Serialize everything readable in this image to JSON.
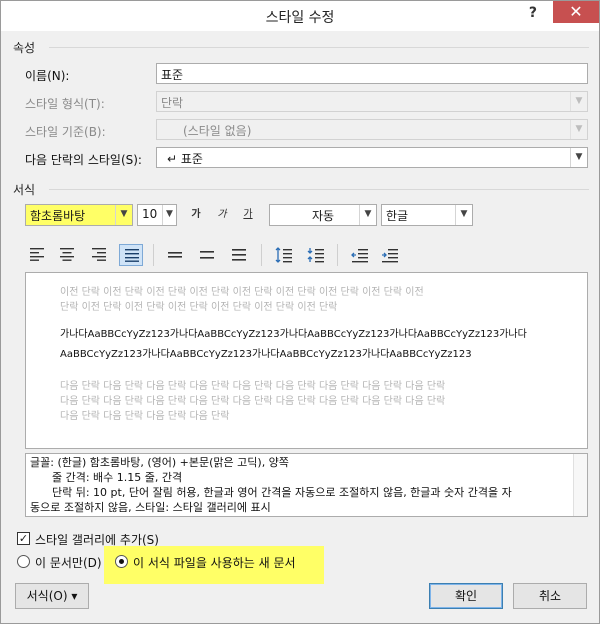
{
  "window": {
    "title": "스타일 수정",
    "help_label": "?",
    "close_label": "✕"
  },
  "properties": {
    "section_label": "속성",
    "name": {
      "label": "이름(N):",
      "value": "표준"
    },
    "style_type": {
      "label": "스타일 형식(T):",
      "value": "단락"
    },
    "based_on": {
      "label": "스타일 기준(B):",
      "value": "(스타일 없음)"
    },
    "next_style": {
      "label": "다음 단락의 스타일(S):",
      "value": "↵ 표준"
    }
  },
  "formatting": {
    "section_label": "서식",
    "font": "함초롬바탕",
    "size": "10",
    "bold_label": "가",
    "italic_label": "가",
    "underline_label": "가",
    "color": "자동",
    "script": "한글",
    "highlight_color": "#ffff66"
  },
  "preview": {
    "previous_lines": [
      "이전 단락 이전 단락 이전 단락 이전 단락 이전 단락 이전 단락 이전 단락 이전 단락 이전",
      "단락 이전 단락 이전 단락 이전 단락 이전 단락 이전 단락 이전 단락"
    ],
    "sample_lines": [
      "가나다AaBBCcYyZz123가나다AaBBCcYyZz123가나다AaBBCcYyZz123가나다AaBBCcYyZz123가나다",
      "AaBBCcYyZz123가나다AaBBCcYyZz123가나다AaBBCcYyZz123가나다AaBBCcYyZz123"
    ],
    "next_lines": [
      "다음 단락 다음 단락 다음 단락 다음 단락 다음 단락 다음 단락 다음 단락 다음 단락 다음 단락",
      "다음 단락 다음 단락 다음 단락 다음 단락 다음 단락 다음 단락 다음 단락 다음 단락 다음 단락",
      "다음 단락 다음 단락 다음 단락 다음 단락"
    ]
  },
  "description": {
    "line1": "글꼴: (한글) 함초롬바탕, (영어) +본문(맑은 고딕), 양쪽",
    "line2": "줄 간격: 배수 1.15 줄, 간격",
    "line3": "단락 뒤: 10 pt, 단어 잘림 허용, 한글과 영어 간격을 자동으로 조절하지 않음, 한글과 숫자 간격을 자",
    "line4": "동으로 조절하지 않음, 스타일: 스타일 갤러리에 표시"
  },
  "options": {
    "add_to_gallery": {
      "label": "스타일 갤러리에 추가(S)",
      "checked": true
    },
    "only_this_document": {
      "label": "이 문서만(D)",
      "checked": false
    },
    "new_documents": {
      "label": "이 서식 파일을 사용하는 새 문서",
      "checked": true
    }
  },
  "buttons": {
    "format": "서식(O) ▾",
    "ok": "확인",
    "cancel": "취소"
  }
}
